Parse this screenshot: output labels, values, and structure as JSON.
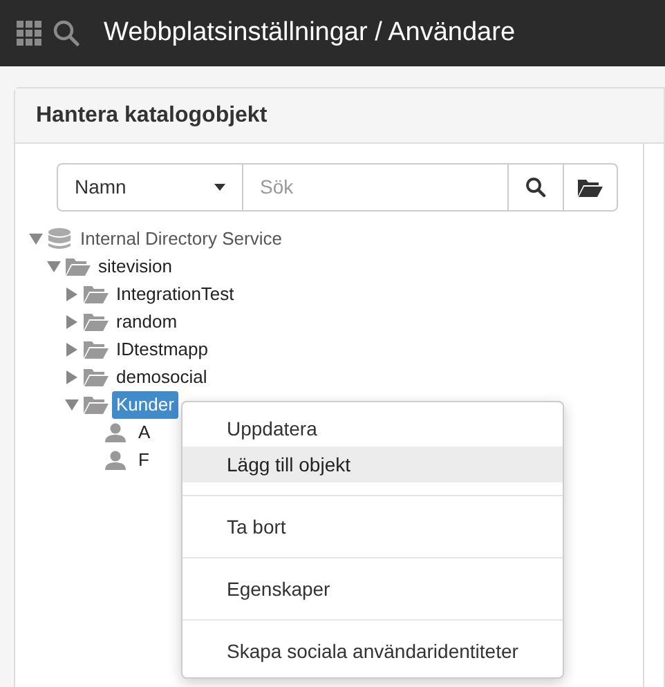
{
  "top_bar": {
    "title": "Webbplatsinställningar / Användare"
  },
  "panel": {
    "title": "Hantera katalogobjekt"
  },
  "search": {
    "dropdown": "Namn",
    "placeholder": "Sök"
  },
  "tree": [
    {
      "kind": "directory",
      "label": "Internal Directory Service",
      "expanded": true,
      "selected": false,
      "children": [
        {
          "kind": "folder",
          "label": "sitevision",
          "expanded": true,
          "selected": false,
          "children": [
            {
              "kind": "folder",
              "label": "IntegrationTest",
              "expanded": false,
              "selected": false
            },
            {
              "kind": "folder",
              "label": "random",
              "expanded": false,
              "selected": false
            },
            {
              "kind": "folder",
              "label": "IDtestmapp",
              "expanded": false,
              "selected": false
            },
            {
              "kind": "folder",
              "label": "demosocial",
              "expanded": false,
              "selected": false
            },
            {
              "kind": "folder",
              "label": "Kunder",
              "expanded": true,
              "selected": true,
              "children": [
                {
                  "kind": "user",
                  "label": "A",
                  "selected": false
                },
                {
                  "kind": "user",
                  "label": "F",
                  "selected": false
                }
              ]
            }
          ]
        }
      ]
    }
  ],
  "context_menu": {
    "groups": [
      {
        "items": [
          {
            "label": "Uppdatera",
            "selected": false
          },
          {
            "label": "Lägg till objekt",
            "selected": true
          }
        ]
      },
      {
        "items": [
          {
            "label": "Ta bort",
            "selected": false
          }
        ]
      },
      {
        "items": [
          {
            "label": "Egenskaper",
            "selected": false
          }
        ]
      },
      {
        "items": [
          {
            "label": "Skapa sociala användaridentiteter",
            "selected": false
          }
        ]
      }
    ]
  }
}
